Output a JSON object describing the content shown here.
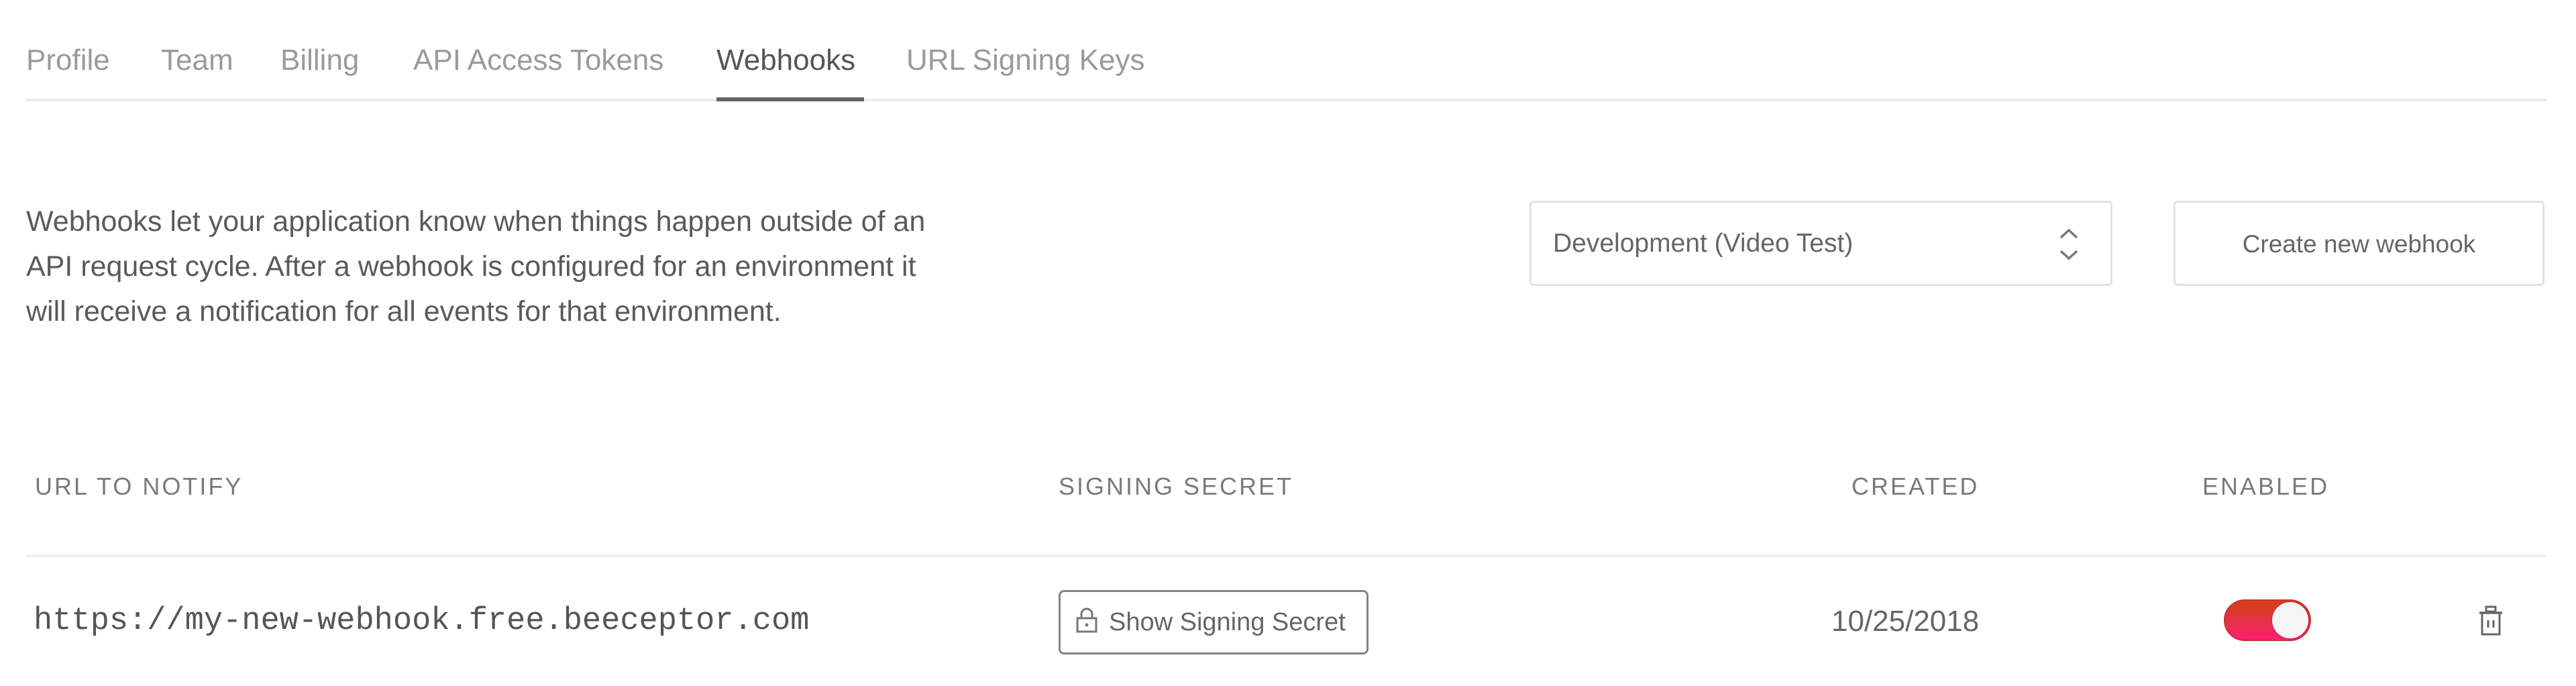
{
  "tabs": [
    {
      "label": "Profile",
      "active": false
    },
    {
      "label": "Team",
      "active": false
    },
    {
      "label": "Billing",
      "active": false
    },
    {
      "label": "API Access Tokens",
      "active": false
    },
    {
      "label": "Webhooks",
      "active": true
    },
    {
      "label": "URL Signing Keys",
      "active": false
    }
  ],
  "description": "Webhooks let your application know when things happen outside of an API request cycle. After a webhook is configured for an environment it will receive a notification for all events for that environment.",
  "description_lines": [
    "Webhooks let your application know when things happen outside of an",
    "API request cycle. After a webhook is configured for an environment it",
    "will receive a notification for all events for that environment."
  ],
  "environment_select": {
    "value": "Development (Video Test)",
    "icon": "up-down-chevron-icon"
  },
  "create_button": {
    "label": "Create new webhook"
  },
  "table": {
    "headers": {
      "url": "URL TO NOTIFY",
      "secret": "SIGNING SECRET",
      "created": "CREATED",
      "enabled": "ENABLED"
    },
    "rows": [
      {
        "url": "https://my-new-webhook.free.beeceptor.com",
        "secret_button": "Show Signing Secret",
        "secret_icon": "lock-icon",
        "created": "10/25/2018",
        "enabled": true,
        "delete_icon": "trash-icon"
      }
    ]
  },
  "colors": {
    "toggle_on_top": "#d5400f",
    "toggle_on_bottom": "#ff1e72",
    "active_tab_underline": "#666666",
    "divider": "#ebebeb"
  }
}
